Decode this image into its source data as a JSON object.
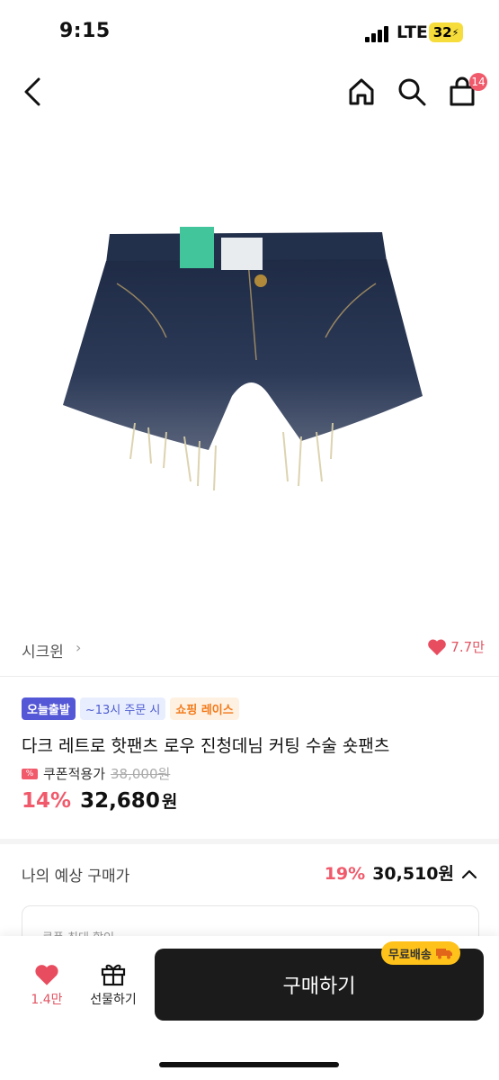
{
  "status_bar": {
    "time": "9:15",
    "network": "LTE",
    "battery": "32"
  },
  "nav": {
    "cart_count": "14"
  },
  "brand": {
    "name": "시크윈",
    "like_count": "7.7만"
  },
  "badges": {
    "today": "오늘출발",
    "cutoff": "~13시 주문 시",
    "race": "쇼핑 레이스"
  },
  "product": {
    "title": "다크 레트로 핫팬츠 로우 진청데님 커팅 수술 숏팬츠",
    "coupon_label": "쿠폰적용가",
    "original_price": "38,000원",
    "discount": "14%",
    "price": "32,680",
    "price_unit": "원"
  },
  "estimate": {
    "label": "나의 예상 구매가",
    "discount": "19%",
    "price": "30,510원",
    "coupon_box_text": "쿠폰 최대 할인"
  },
  "bottom": {
    "like_count": "1.4만",
    "gift_label": "선물하기",
    "buy_label": "구매하기",
    "free_shipping": "무료배송"
  },
  "colors": {
    "accent": "#f05a6b",
    "today_badge": "#5558d6",
    "free_shipping": "#ffc21a",
    "buy_button": "#1b1b1b"
  }
}
